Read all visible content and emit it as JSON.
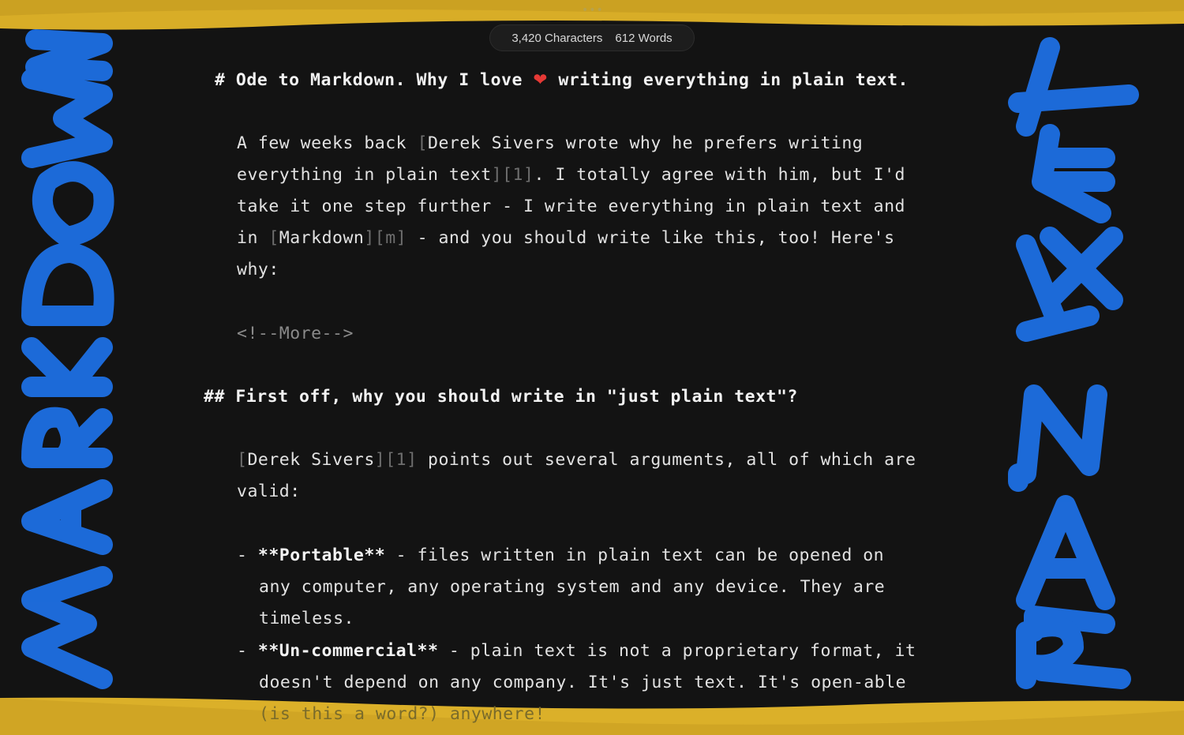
{
  "window": {
    "menu_dots": "•••"
  },
  "stats": {
    "characters": "3,420 Characters",
    "words": "612 Words"
  },
  "document": {
    "h1": {
      "marker": "#",
      "before": "Ode to Markdown. Why I love",
      "heart": "❤",
      "after": "writing everything in plain text."
    },
    "p1": {
      "l1_a": "A few weeks back ",
      "l1_b": "[",
      "l1_c": "Derek Sivers wrote why he prefers writing",
      "l2_a": "everything in plain text",
      "l2_b": "][1]",
      "l2_c": ". I totally agree with him, but I'd",
      "l3": "take it one step further - I write everything in plain text and",
      "l4_a": "in ",
      "l4_b": "[",
      "l4_c": "Markdown",
      "l4_d": "][m]",
      "l4_e": " - and you should write like this, too! Here's",
      "l5": "why:"
    },
    "more_comment": "<!--More-->",
    "h2": {
      "marker": "##",
      "text": "First off, why you should write in \"just plain text\"?"
    },
    "p2": {
      "l1_a": "[",
      "l1_b": "Derek Sivers",
      "l1_c": "][1]",
      "l1_d": " points out several arguments, all of which are",
      "l2": "valid:"
    },
    "list": {
      "item1": {
        "dash": "- ",
        "bold": "**Portable**",
        "l1": " - files written in plain text can be opened on",
        "l2": "any computer, any operating system and any device. They are",
        "l3": "timeless."
      },
      "item2": {
        "dash": "- ",
        "bold": "**Un-commercial**",
        "l1": " - plain text is not a proprietary format, it",
        "l2": "doesn't depend on any company. It's just text. It's open-able",
        "l3": "(is this a word?) anywhere!"
      }
    }
  },
  "decorations": {
    "left_lettering": "MARKDOWN",
    "right_lettering": "PLAIN TEXT"
  },
  "colors": {
    "background": "#131313",
    "tape_yellow": "#e2b422",
    "brush_blue": "#1a6ee6"
  }
}
